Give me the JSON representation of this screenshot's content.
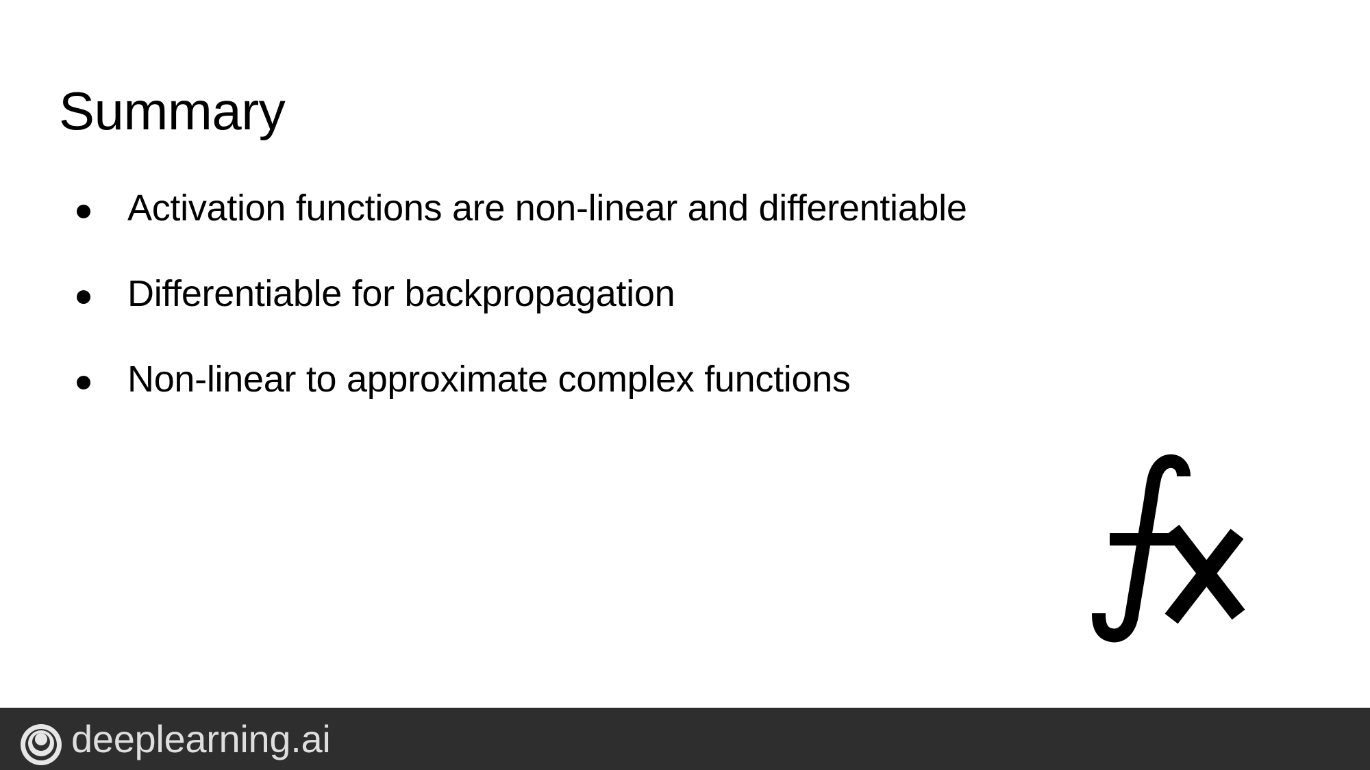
{
  "slide": {
    "title": "Summary",
    "bullets": [
      "Activation functions are non-linear and differentiable",
      "Differentiable for backpropagation",
      "Non-linear to approximate complex functions"
    ],
    "illustration_icon": "function-fx-icon"
  },
  "footer": {
    "brand": "deeplearning.ai",
    "logo_icon": "deeplearning-logo-icon",
    "background_color": "#2e2e2e",
    "text_color": "#dedede"
  }
}
